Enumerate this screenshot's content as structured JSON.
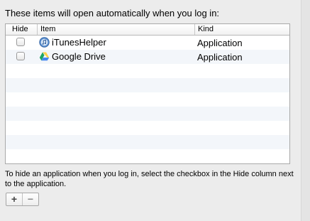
{
  "heading": "These items will open automatically when you log in:",
  "table": {
    "columns": {
      "hide": "Hide",
      "item": "Item",
      "kind": "Kind"
    },
    "rows": [
      {
        "name": "iTunesHelper",
        "kind": "Application",
        "hidden": false,
        "icon": "itunes-icon"
      },
      {
        "name": "Google Drive",
        "kind": "Application",
        "hidden": false,
        "icon": "google-drive-icon"
      }
    ]
  },
  "footer_note": "To hide an application when you log in, select the checkbox in the Hide column next to the application.",
  "buttons": {
    "add": "+",
    "remove": "−"
  },
  "colors": {
    "window_background": "#ececec",
    "row_alternate": "#f3f6fa",
    "google_drive_green": "#1fa463",
    "google_drive_yellow": "#ffd04b",
    "google_drive_blue": "#4688f1"
  }
}
